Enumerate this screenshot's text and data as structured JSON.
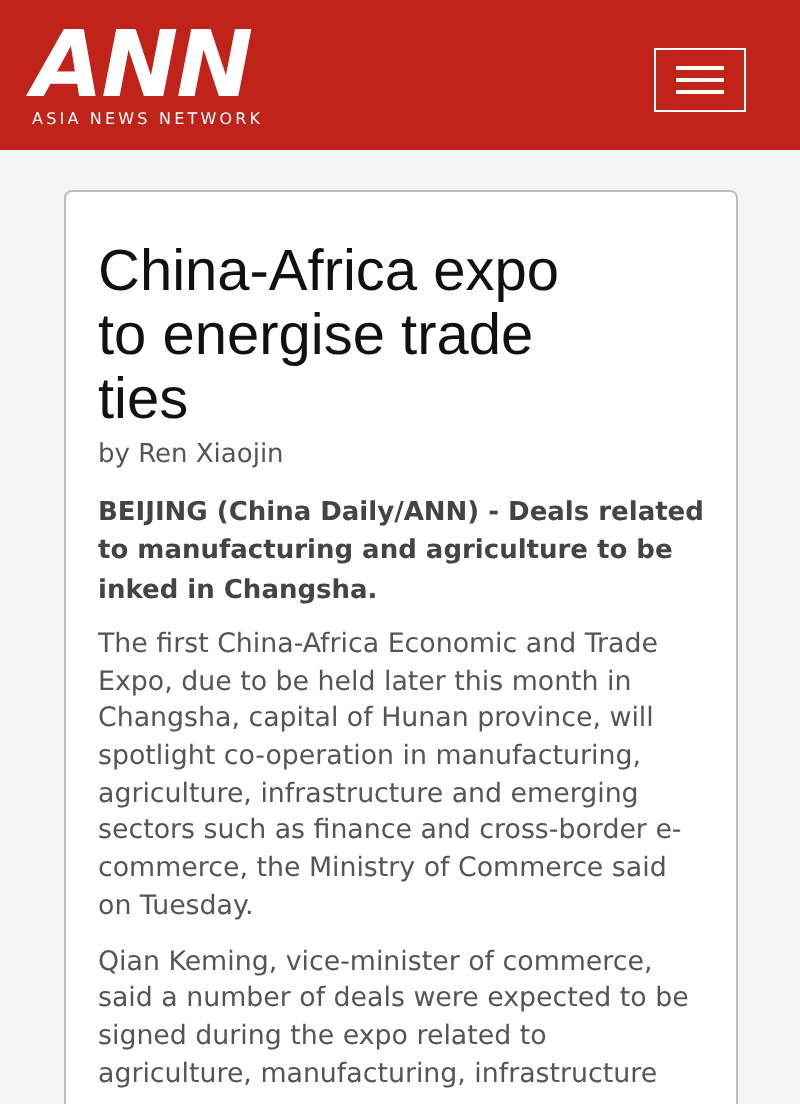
{
  "header": {
    "logo": "ANN",
    "tagline": "ASIA NEWS NETWORK"
  },
  "article": {
    "title": "China-Africa expo to energise trade ties",
    "byline": "by Ren Xiaojin",
    "lead": "BEIJING (China Daily/ANN) - Deals related to manufacturing and agriculture to be inked in Changsha.",
    "paragraphs": [
      "The first China-Africa Economic and Trade Expo, due to be held later this month in Changsha, capital of Hunan province, will spotlight co-operation in manufacturing, agriculture, infrastructure and emerging sectors such as finance and cross-border e-commerce, the Ministry of Commerce said on Tuesday.",
      "Qian Keming, vice-minister of commerce, said a number of deals were expected to be signed during the expo related to agriculture, manufacturing, infrastructure"
    ]
  }
}
